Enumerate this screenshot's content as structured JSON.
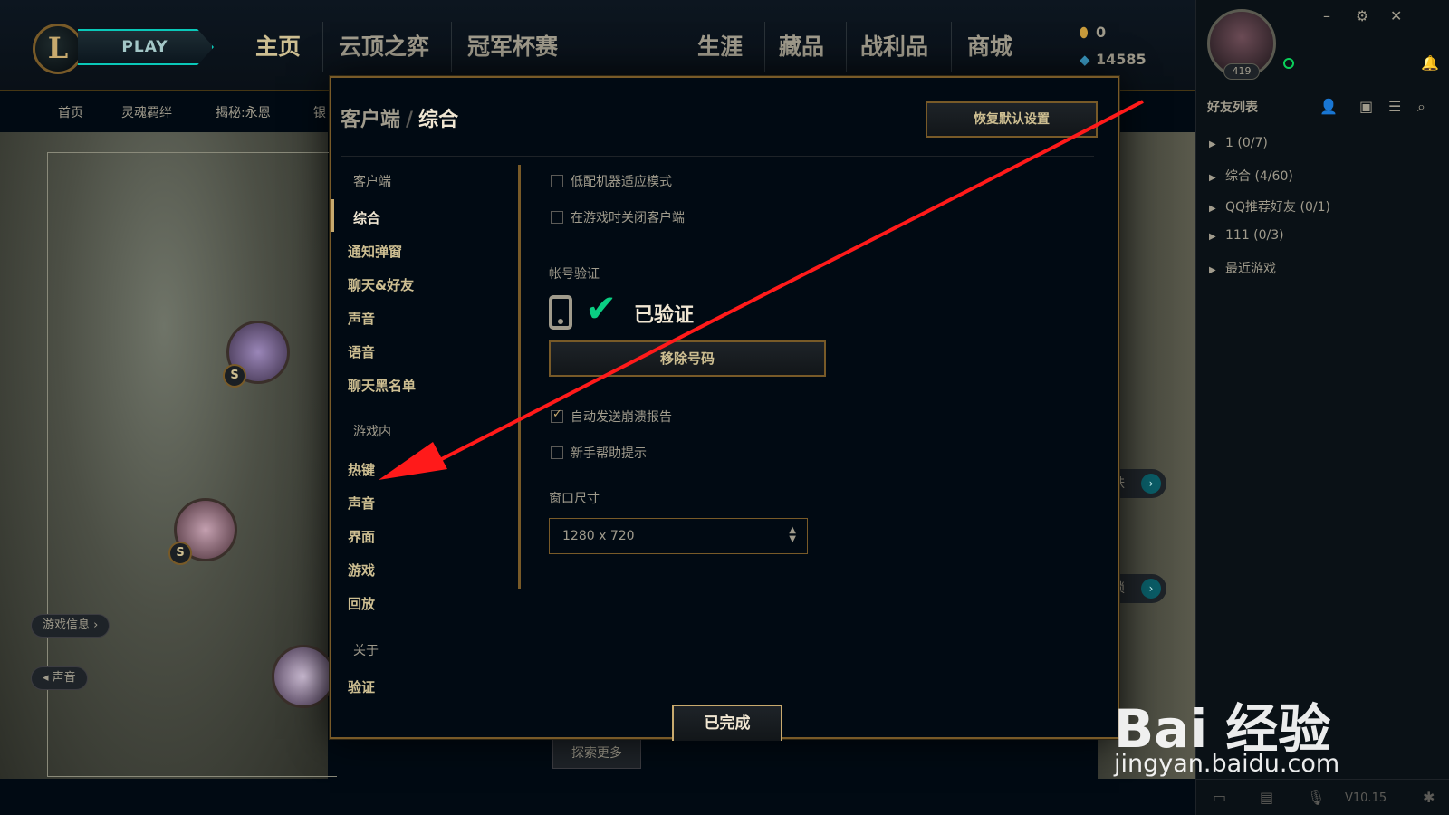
{
  "topbar": {
    "play_label": "PLAY",
    "tabs": [
      "主页",
      "云顶之弈",
      "冠军杯赛",
      "生涯",
      "藏品",
      "战利品",
      "商城"
    ],
    "currency_rp": "0",
    "currency_be": "14585"
  },
  "subnav": {
    "items": [
      "首页",
      "灵魂羁绊",
      "揭秘:永恩",
      "银"
    ]
  },
  "scene": {
    "pill_game_info": "游戏信息",
    "pill_sound": "声音",
    "explore_more": "探索更多",
    "side_pill_1": "肤",
    "side_pill_2": "锁"
  },
  "social": {
    "level": "419",
    "friends_title": "好友列表",
    "groups": [
      "1 (0/7)",
      "综合 (4/60)",
      "QQ推荐好友 (0/1)",
      "111 (0/3)",
      "最近游戏"
    ],
    "version": "V10.15"
  },
  "modal": {
    "crumb_parent": "客户端",
    "crumb_sep": "/",
    "crumb_current": "综合",
    "reset_label": "恢复默认设置",
    "menu": {
      "section_client": "客户端",
      "client_items": [
        "综合",
        "通知弹窗",
        "聊天&好友",
        "声音",
        "语音",
        "聊天黑名单"
      ],
      "section_ingame": "游戏内",
      "ingame_items": [
        "热键",
        "声音",
        "界面",
        "游戏",
        "回放"
      ],
      "section_about": "关于",
      "about_items": [
        "验证"
      ]
    },
    "options": {
      "low_spec": "低配机器适应模式",
      "close_client": "在游戏时关闭客户端",
      "account_verify_label": "帐号验证",
      "verified_text": "已验证",
      "remove_number": "移除号码",
      "auto_crash_report": "自动发送崩溃报告",
      "newbie_tips": "新手帮助提示",
      "window_size_label": "窗口尺寸",
      "window_size_value": "1280 x 720"
    },
    "done_label": "已完成"
  },
  "watermark": {
    "logo_text": "Bai 经验",
    "url": "jingyan.baidu.com"
  },
  "colors": {
    "gold": "#c8aa6e",
    "gold_dark": "#785a28",
    "text": "#a09b8c",
    "text_bright": "#f0e6d2",
    "bg": "#010a13",
    "verified_green": "#0acf83",
    "annotation_red": "#ff1a1a"
  }
}
